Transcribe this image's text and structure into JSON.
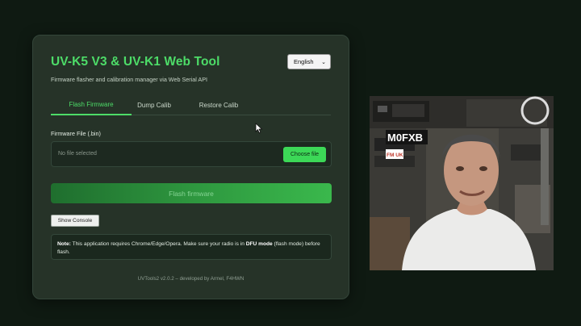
{
  "app": {
    "title": "UV-K5 V3 & UV-K1 Web Tool",
    "subtitle": "Firmware flasher and calibration manager via Web Serial API",
    "accent_color": "#4ddc68"
  },
  "language": {
    "selected": "English"
  },
  "tabs": [
    {
      "label": "Flash Firmware",
      "active": true
    },
    {
      "label": "Dump Calib",
      "active": false
    },
    {
      "label": "Restore Calib",
      "active": false
    }
  ],
  "firmware": {
    "field_label": "Firmware File (.bin)",
    "status": "No file selected",
    "choose_label": "Choose file"
  },
  "actions": {
    "flash_label": "Flash firmware",
    "console_label": "Show Console"
  },
  "note": {
    "prefix": "Note:",
    "text_before_dfu": " This application requires Chrome/Edge/Opera. Make sure your radio is in ",
    "dfu_label": "DFU mode",
    "text_after_dfu": " (flash mode) before flash."
  },
  "footer": {
    "text": "UVTools2 v2.0.2 – developed by Armel, F4HWN"
  },
  "webcam": {
    "overlay_text": "M0FXB",
    "logo_text": "FM UK"
  }
}
